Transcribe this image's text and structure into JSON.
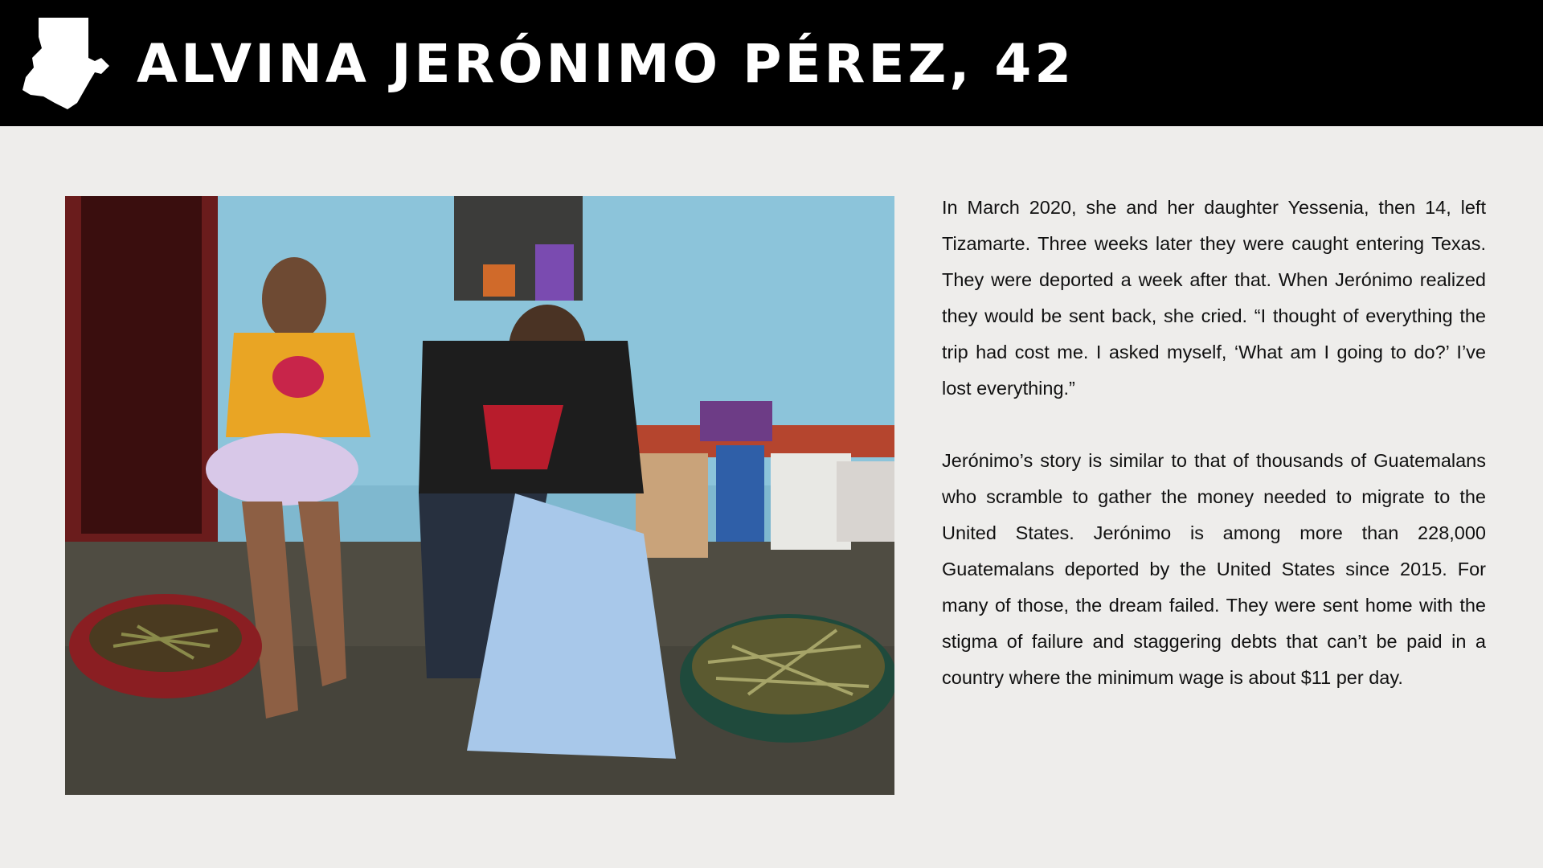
{
  "header": {
    "title": "ALVINA JERÓNIMO PÉREZ, 42",
    "icon": "guatemala-map-icon",
    "background_color": "#000000",
    "text_color": "#ffffff"
  },
  "photo": {
    "icon": "photo-image"
  },
  "article": {
    "paragraphs": [
      "In March 2020, she and her daughter Yessenia, then 14, left Tizamarte. Three weeks later they were caught entering Texas. They were deported a week after that. When Jerónimo realized they would be sent back, she cried. “I thought of everything the trip had cost me. I asked myself, ‘What am I going to do?’ I’ve lost everything.”",
      "Jerónimo’s story is similar to that of thousands of Guatemalans who scramble to gather the money needed to migrate to the United States. Jerónimo is among more than 228,000 Guatemalans deported by the United States since 2015. For many of those, the dream failed. They were sent home with the stigma of failure and staggering debts that can’t be paid in a country where the minimum wage is about $11 per day."
    ]
  },
  "colors": {
    "page_background": "#eeedeb",
    "body_text": "#111111"
  }
}
